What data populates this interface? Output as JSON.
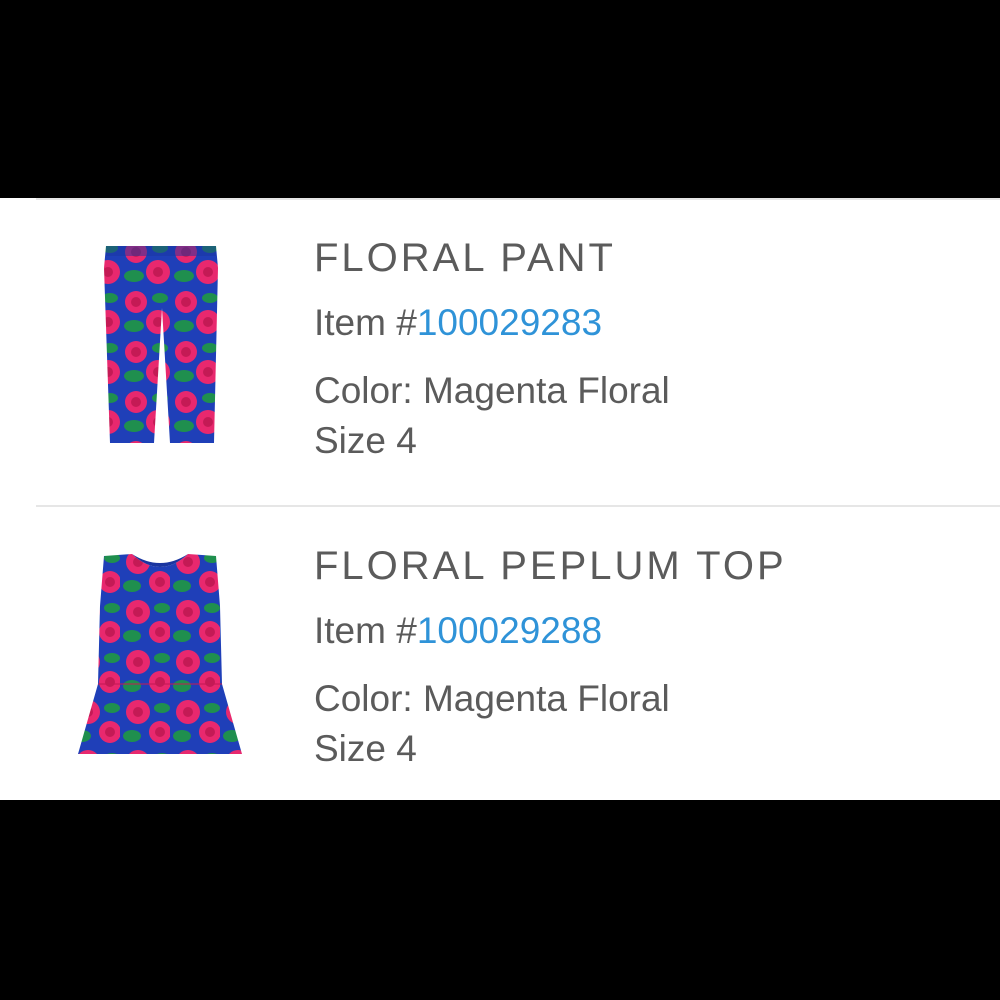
{
  "products": [
    {
      "name": "FLORAL PANT",
      "item_prefix": "Item #",
      "item_number": "100029283",
      "color": "Color: Magenta Floral",
      "size": "Size 4",
      "image_icon": "floral-pant-image"
    },
    {
      "name": "FLORAL PEPLUM TOP",
      "item_prefix": "Item #",
      "item_number": "100029288",
      "color": "Color: Magenta Floral",
      "size": "Size 4",
      "image_icon": "floral-peplum-top-image"
    }
  ],
  "colors": {
    "background_bar": "#000000",
    "panel": "#ffffff",
    "text": "#5b5b5b",
    "link": "#2f93d8",
    "floral_base": "#1f3fb8",
    "floral_rose": "#e8286e",
    "floral_leaf": "#1f8f4e"
  }
}
